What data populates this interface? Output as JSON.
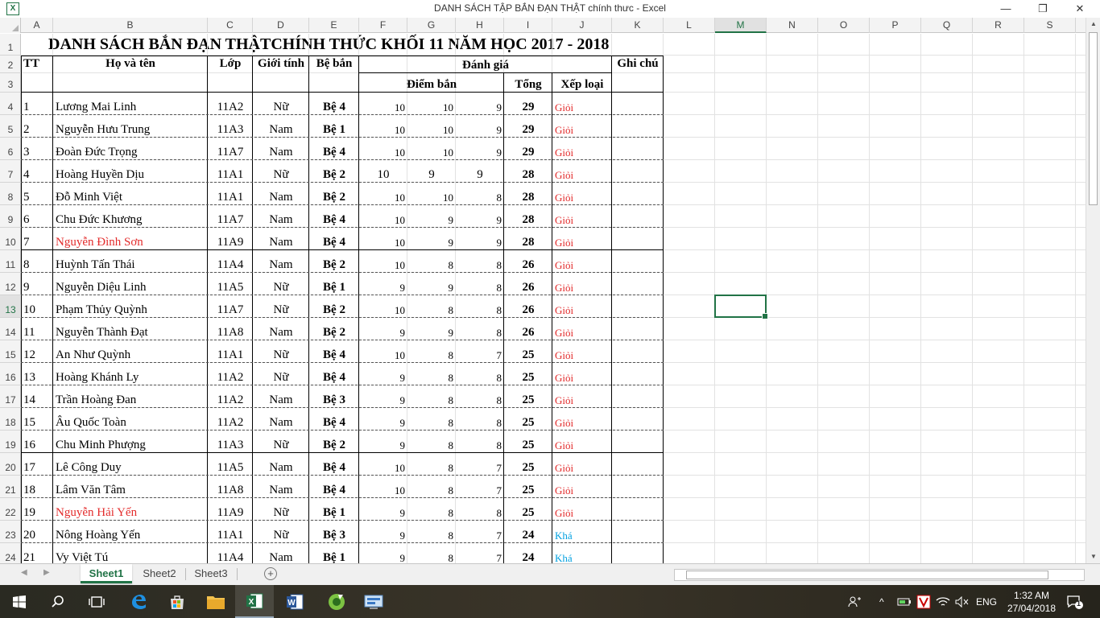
{
  "window": {
    "title": "DANH SÁCH TẬP BẮN ĐẠN THẬT chính thưc - Excel",
    "minimize": "—",
    "restore": "❐",
    "close": "✕"
  },
  "columns": [
    "A",
    "B",
    "C",
    "D",
    "E",
    "F",
    "G",
    "H",
    "I",
    "J",
    "K",
    "L",
    "M",
    "N",
    "O",
    "P",
    "Q",
    "R",
    "S"
  ],
  "selected_column": "M",
  "selected_row": "13",
  "rows_numbers": [
    "1",
    "2",
    "3",
    "4",
    "5",
    "6",
    "7",
    "8",
    "9",
    "10",
    "11",
    "12",
    "13",
    "14",
    "15",
    "16",
    "17",
    "18",
    "19",
    "20",
    "21",
    "22",
    "23",
    "24"
  ],
  "sheet": {
    "title": "DANH SÁCH BẮN ĐẠN THẬTCHÍNH THỨC  KHỐI 11 NĂM HỌC 2017 - 2018",
    "headers": {
      "tt": "TT",
      "name": "Họ và tên",
      "class": "Lớp",
      "gender": "Giới tính",
      "target": "Bệ bắn",
      "evaluation": "Đánh giá",
      "scores": "Điểm bắn",
      "total": "Tổng",
      "rank": "Xếp loại",
      "note": "Ghi chú"
    },
    "rows": [
      {
        "tt": "1",
        "name": "Lương Mai Linh",
        "class": "11A2",
        "gender": "Nữ",
        "target": "Bệ 4",
        "s1": "10",
        "s2": "10",
        "s3": "9",
        "total": "29",
        "rank": "Giỏi",
        "red": false,
        "big": false
      },
      {
        "tt": "2",
        "name": "Nguyễn Hưu Trung",
        "class": "11A3",
        "gender": "Nam",
        "target": "Bệ 1",
        "s1": "10",
        "s2": "10",
        "s3": "9",
        "total": "29",
        "rank": "Giỏi",
        "red": false,
        "big": false
      },
      {
        "tt": "3",
        "name": "Đoàn Đức Trọng",
        "class": "11A7",
        "gender": "Nam",
        "target": "Bệ 4",
        "s1": "10",
        "s2": "10",
        "s3": "9",
        "total": "29",
        "rank": "Giỏi",
        "red": false,
        "big": false
      },
      {
        "tt": "4",
        "name": "Hoàng Huyền Dịu",
        "class": "11A1",
        "gender": "Nữ",
        "target": "Bệ 2",
        "s1": "10",
        "s2": "9",
        "s3": "9",
        "total": "28",
        "rank": "Giỏi",
        "red": false,
        "big": true
      },
      {
        "tt": "5",
        "name": "Đỗ Minh Việt",
        "class": "11A1",
        "gender": "Nam",
        "target": "Bệ 2",
        "s1": "10",
        "s2": "10",
        "s3": "8",
        "total": "28",
        "rank": "Giỏi",
        "red": false,
        "big": false
      },
      {
        "tt": "6",
        "name": "Chu Đức Khương",
        "class": "11A7",
        "gender": "Nam",
        "target": "Bệ 4",
        "s1": "10",
        "s2": "9",
        "s3": "9",
        "total": "28",
        "rank": "Giỏi",
        "red": false,
        "big": false
      },
      {
        "tt": "7",
        "name": "Nguyễn Đình Sơn",
        "class": "11A9",
        "gender": "Nam",
        "target": "Bệ 4",
        "s1": "10",
        "s2": "9",
        "s3": "9",
        "total": "28",
        "rank": "Giỏi",
        "red": true,
        "big": false
      },
      {
        "tt": "8",
        "name": "Huỳnh Tấn Thái",
        "class": "11A4",
        "gender": "Nam",
        "target": "Bệ 2",
        "s1": "10",
        "s2": "8",
        "s3": "8",
        "total": "26",
        "rank": "Giỏi",
        "red": false,
        "big": false
      },
      {
        "tt": "9",
        "name": "Nguyễn Diệu Linh",
        "class": "11A5",
        "gender": "Nữ",
        "target": "Bệ 1",
        "s1": "9",
        "s2": "9",
        "s3": "8",
        "total": "26",
        "rank": "Giỏi",
        "red": false,
        "big": false
      },
      {
        "tt": "10",
        "name": "Phạm Thủy Quỳnh",
        "class": "11A7",
        "gender": "Nữ",
        "target": "Bệ 2",
        "s1": "10",
        "s2": "8",
        "s3": "8",
        "total": "26",
        "rank": "Giỏi",
        "red": false,
        "big": false
      },
      {
        "tt": "11",
        "name": "Nguyễn Thành Đạt",
        "class": "11A8",
        "gender": "Nam",
        "target": "Bệ 2",
        "s1": "9",
        "s2": "9",
        "s3": "8",
        "total": "26",
        "rank": "Giỏi",
        "red": false,
        "big": false
      },
      {
        "tt": "12",
        "name": "An Như Quỳnh",
        "class": "11A1",
        "gender": "Nữ",
        "target": "Bệ 4",
        "s1": "10",
        "s2": "8",
        "s3": "7",
        "total": "25",
        "rank": "Giỏi",
        "red": false,
        "big": false
      },
      {
        "tt": "13",
        "name": "Hoàng Khánh Ly",
        "class": "11A2",
        "gender": "Nữ",
        "target": "Bệ 4",
        "s1": "9",
        "s2": "8",
        "s3": "8",
        "total": "25",
        "rank": "Giỏi",
        "red": false,
        "big": false
      },
      {
        "tt": "14",
        "name": "Trần Hoàng Đan",
        "class": "11A2",
        "gender": "Nam",
        "target": "Bệ 3",
        "s1": "9",
        "s2": "8",
        "s3": "8",
        "total": "25",
        "rank": "Giỏi",
        "red": false,
        "big": false
      },
      {
        "tt": "15",
        "name": "Âu Quốc Toàn",
        "class": "11A2",
        "gender": "Nam",
        "target": "Bệ 4",
        "s1": "9",
        "s2": "8",
        "s3": "8",
        "total": "25",
        "rank": "Giỏi",
        "red": false,
        "big": false
      },
      {
        "tt": "16",
        "name": "Chu Minh Phượng",
        "class": "11A3",
        "gender": "Nữ",
        "target": "Bệ 2",
        "s1": "9",
        "s2": "8",
        "s3": "8",
        "total": "25",
        "rank": "Giỏi",
        "red": false,
        "big": false
      },
      {
        "tt": "17",
        "name": "Lê Công Duy",
        "class": "11A5",
        "gender": "Nam",
        "target": "Bệ 4",
        "s1": "10",
        "s2": "8",
        "s3": "7",
        "total": "25",
        "rank": "Giỏi",
        "red": false,
        "big": false
      },
      {
        "tt": "18",
        "name": "Lâm Văn Tâm",
        "class": "11A8",
        "gender": "Nam",
        "target": "Bệ 4",
        "s1": "10",
        "s2": "8",
        "s3": "7",
        "total": "25",
        "rank": "Giỏi",
        "red": false,
        "big": false
      },
      {
        "tt": "19",
        "name": "Nguyễn Hải Yến",
        "class": "11A9",
        "gender": "Nữ",
        "target": "Bệ 1",
        "s1": "9",
        "s2": "8",
        "s3": "8",
        "total": "25",
        "rank": "Giỏi",
        "red": true,
        "big": false
      },
      {
        "tt": "20",
        "name": "Nông Hoàng Yến",
        "class": "11A1",
        "gender": "Nữ",
        "target": "Bệ 3",
        "s1": "9",
        "s2": "8",
        "s3": "7",
        "total": "24",
        "rank": "Khá",
        "red": false,
        "big": false
      },
      {
        "tt": "21",
        "name": "Vy Việt Tú",
        "class": "11A4",
        "gender": "Nam",
        "target": "Bệ 1",
        "s1": "9",
        "s2": "8",
        "s3": "7",
        "total": "24",
        "rank": "Khá",
        "red": false,
        "big": false
      }
    ]
  },
  "colors": {
    "accent": "#217346",
    "good": "#e32b2b",
    "fair": "#00a0e0"
  },
  "tabs": [
    "Sheet1",
    "Sheet2",
    "Sheet3"
  ],
  "active_tab": "Sheet1",
  "taskbar": {
    "apps": [
      "start-icon",
      "search-icon",
      "task-view-icon",
      "edge-icon",
      "store-icon",
      "explorer-icon",
      "excel-icon",
      "word-icon",
      "corel-icon",
      "app-icon"
    ],
    "lang": "ENG",
    "time": "1:32 AM",
    "date": "27/04/2018",
    "notifications": "1"
  }
}
